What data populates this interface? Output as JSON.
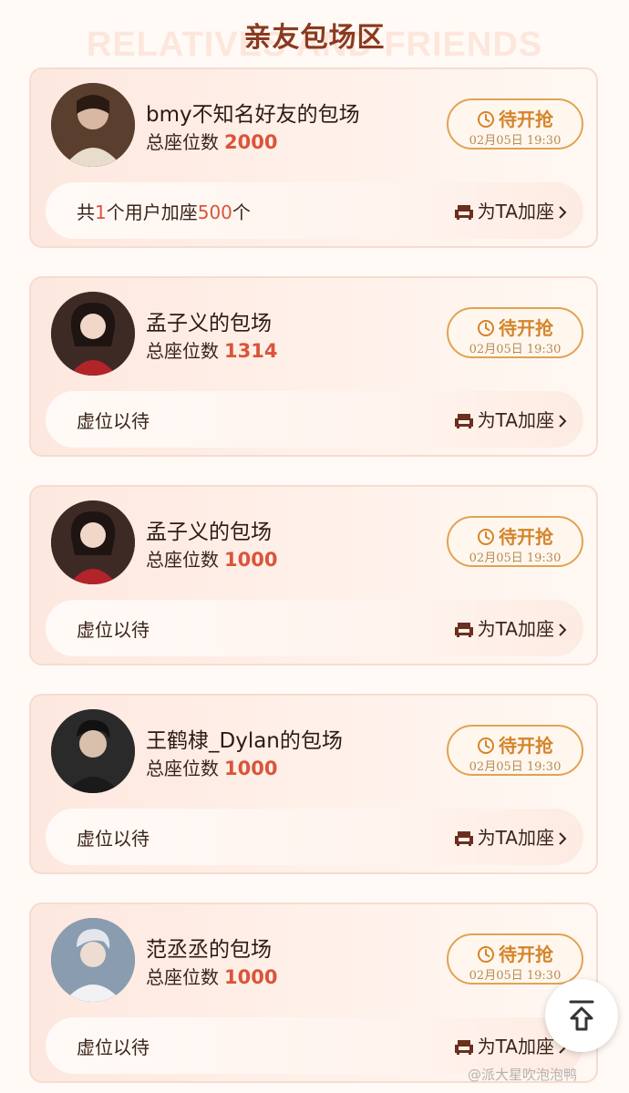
{
  "section": {
    "title": "亲友包场区",
    "watermark_en": "RELATIVES AND FRIENDS"
  },
  "icons": {
    "clock": "clock-icon",
    "sofa": "sofa-icon",
    "chevron": "chevron-right-icon",
    "back_to_top": "back-to-top-icon"
  },
  "colors": {
    "accent_red": "#d9553a",
    "pending_orange": "#d5842a",
    "title_brown": "#8a3a1f"
  },
  "cards": [
    {
      "name": "bmy不知名好友的包场",
      "seats_label": "总座位数",
      "seats_value": "2000",
      "status": "待开抢",
      "time": "02月05日 19:30",
      "info_parts": [
        "共",
        "1",
        "个用户加座",
        "500",
        "个"
      ],
      "action": "为TA加座"
    },
    {
      "name": "孟子义的包场",
      "seats_label": "总座位数",
      "seats_value": "1314",
      "status": "待开抢",
      "time": "02月05日 19:30",
      "info": "虚位以待",
      "action": "为TA加座"
    },
    {
      "name": "孟子义的包场",
      "seats_label": "总座位数",
      "seats_value": "1000",
      "status": "待开抢",
      "time": "02月05日 19:30",
      "info": "虚位以待",
      "action": "为TA加座"
    },
    {
      "name": "王鹤棣_Dylan的包场",
      "seats_label": "总座位数",
      "seats_value": "1000",
      "status": "待开抢",
      "time": "02月05日 19:30",
      "info": "虚位以待",
      "action": "为TA加座"
    },
    {
      "name": "范丞丞的包场",
      "seats_label": "总座位数",
      "seats_value": "1000",
      "status": "待开抢",
      "time": "02月05日 19:30",
      "info": "虚位以待",
      "action": "为TA加座"
    }
  ],
  "watermark": "@派大星吹泡泡鸭"
}
